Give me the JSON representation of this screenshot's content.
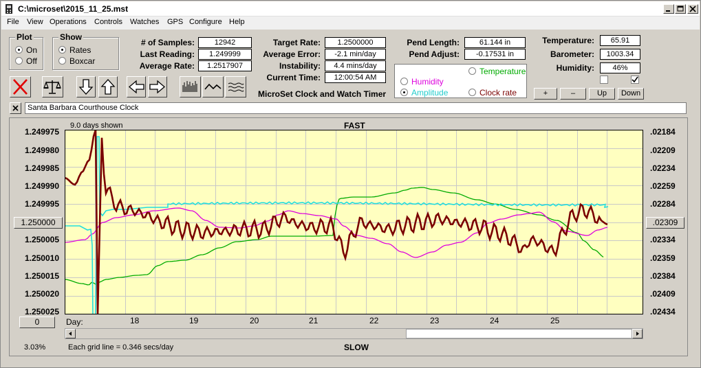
{
  "window": {
    "title": "C:\\microset\\2015_11_25.mst"
  },
  "menu": [
    "File",
    "View",
    "Operations",
    "Controls",
    "Watches",
    "GPS",
    "Configure",
    "Help"
  ],
  "plot_group": {
    "title": "Plot",
    "on_label": "On",
    "off_label": "Off",
    "selected": "On"
  },
  "show_group": {
    "title": "Show",
    "rates_label": "Rates",
    "boxcar_label": "Boxcar",
    "selected": "Rates"
  },
  "stats": {
    "samples_label": "# of Samples:",
    "samples_value": "12942",
    "last_reading_label": "Last Reading:",
    "last_reading_value": "1.249999",
    "avg_rate_label": "Average Rate:",
    "avg_rate_value": "1.2517907",
    "target_rate_label": "Target Rate:",
    "target_rate_value": "1.2500000",
    "avg_error_label": "Average Error:",
    "avg_error_value": "-2.1 min/day",
    "instability_label": "Instability:",
    "instability_value": "4.4 mins/day",
    "current_time_label": "Current Time:",
    "current_time_value": "12:00:54 AM",
    "pend_length_label": "Pend Length:",
    "pend_length_value": "61.144 in",
    "pend_adjust_label": "Pend Adjust:",
    "pend_adjust_value": "-0.17531 in",
    "temperature_label": "Temperature:",
    "temperature_value": "65.91",
    "barometer_label": "Barometer:",
    "barometer_value": "1003.34",
    "humidity_label": "Humidity:",
    "humidity_value": "46%"
  },
  "app_caption": "MicroSet Clock and Watch Timer",
  "right_axis_options": {
    "temperature": "Temperature",
    "humidity": "Humidity",
    "amplitude": "Amplitude",
    "clock_rate": "Clock rate",
    "selected": "Amplitude"
  },
  "colors": {
    "temperature": "#00aa00",
    "humidity": "#dd00dd",
    "amplitude": "#22dddd",
    "rate": "#7a0000",
    "plot_bg": "#ffffc0"
  },
  "scale_buttons": [
    "+",
    "–",
    "Up",
    "Down"
  ],
  "checkboxes": [
    false,
    true
  ],
  "clock_name": "Santa Barbara Courthouse Clock",
  "plot": {
    "days_shown": "9.0 days shown",
    "top_label": "FAST",
    "bottom_label": "SLOW",
    "left_ticks": [
      "1.249975",
      "1.249980",
      "1.249985",
      "1.249990",
      "1.249995",
      "",
      "1.250005",
      "1.250010",
      "1.250015",
      "1.250020",
      "1.250025"
    ],
    "left_center_value": "1.250000",
    "right_ticks": [
      ".02184",
      ".02209",
      ".02234",
      ".02259",
      ".02284",
      "",
      ".02334",
      ".02359",
      ".02384",
      ".02409",
      ".02434"
    ],
    "right_center_value": ".02309",
    "day_axis_label": "Day:",
    "day_ticks": [
      "18",
      "19",
      "20",
      "21",
      "22",
      "23",
      "24",
      "25"
    ],
    "offset_value": "0",
    "percent": "3.03%",
    "grid_note": "Each grid line = 0.346 secs/day"
  }
}
